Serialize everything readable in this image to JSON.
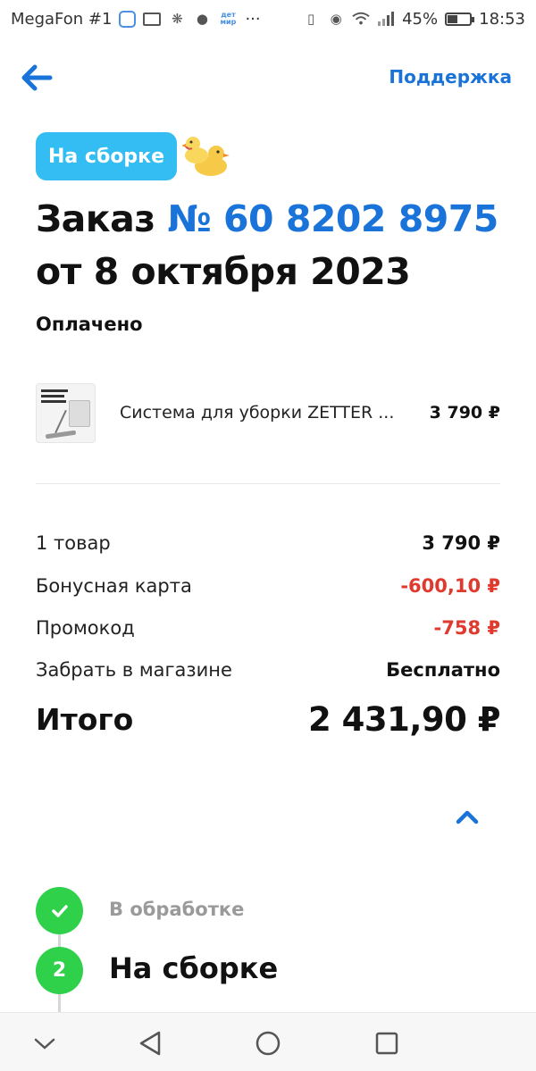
{
  "status_bar": {
    "carrier": "MegaFon #1",
    "dm_logo_text": "дет мир",
    "more": "···",
    "battery_percent": "45%",
    "battery_level": 0.45,
    "time": "18:53"
  },
  "header": {
    "support_label": "Поддержка"
  },
  "order": {
    "status_pill": "На сборке",
    "title_prefix": "Заказ",
    "number": "№ 60 8202 8975",
    "date": "от 8 октября 2023",
    "payment_status": "Оплачено"
  },
  "product": {
    "name": "Система для уборки ZETTER ...",
    "price": "3 790 ₽"
  },
  "summary": {
    "rows": [
      {
        "label": "1 товар",
        "value": "3 790 ₽"
      },
      {
        "label": "Бонусная карта",
        "value": "-600,10 ₽"
      },
      {
        "label": "Промокод",
        "value": "-758 ₽"
      },
      {
        "label": "Забрать в магазине",
        "value": "Бесплатно"
      }
    ],
    "total_label": "Итого",
    "total_value": "2 431,90 ₽"
  },
  "timeline": {
    "steps": [
      {
        "label": "В обработке",
        "state": "done"
      },
      {
        "label": "На сборке",
        "marker": "2",
        "state": "current"
      }
    ]
  },
  "colors": {
    "accent_blue": "#1a73d9",
    "pill_blue": "#33bdf2",
    "negative_red": "#e03a2f",
    "success_green": "#2fd04a"
  }
}
